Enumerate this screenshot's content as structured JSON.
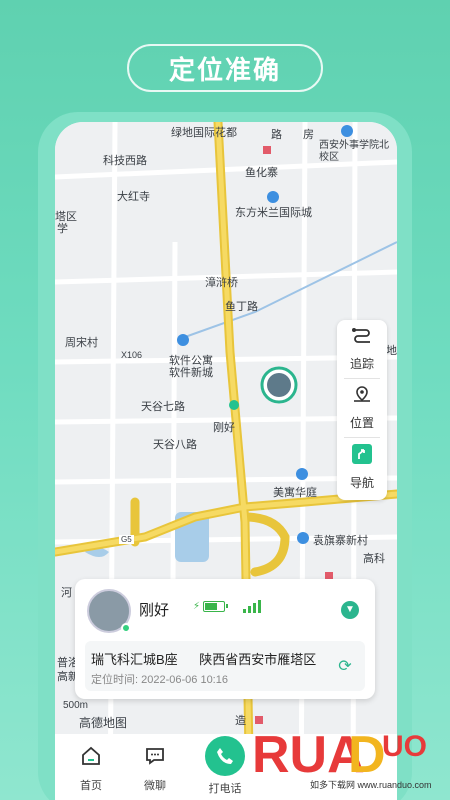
{
  "banner": {
    "title": "定位准确"
  },
  "map": {
    "labels": [
      "绿地国际花都",
      "科技西路",
      "鱼化寨",
      "西安外事学院北校区",
      "大红寺",
      "东方米兰国际城",
      "漳浒桥",
      "鱼丁路",
      "周宋村",
      "软件公寓",
      "软件新城",
      "X106",
      "天谷七路",
      "刚好",
      "天谷八路",
      "美寓华庭",
      "袁旗寨新村",
      "高科",
      "G5",
      "河",
      "普洛",
      "高新",
      "500m",
      "高德地图",
      "塔区",
      "学",
      "房",
      "路",
      "基地",
      "造"
    ],
    "logo": "高德地图"
  },
  "side_panel": {
    "items": [
      {
        "label": "追踪",
        "icon": "route-icon"
      },
      {
        "label": "位置",
        "icon": "map-pin-icon"
      },
      {
        "label": "导航",
        "icon": "navigation-icon"
      }
    ]
  },
  "device": {
    "name": "刚好",
    "battery_level": 0.6,
    "signal_bars": 4,
    "address_parts": [
      "瑞飞科汇城B座",
      "陕西省西安市雁塔区"
    ],
    "time_label": "定位时间:",
    "time_value": "2022-06-06 10:16"
  },
  "nav": {
    "items": [
      {
        "label": "首页",
        "icon": "home-icon"
      },
      {
        "label": "微聊",
        "icon": "chat-icon"
      },
      {
        "label": "打电话",
        "icon": "phone-icon"
      }
    ]
  },
  "watermark": {
    "text": "RUANDUO",
    "subtext": "如多下载网 www.ruanduo.com"
  },
  "colors": {
    "accent": "#23c28f",
    "road_major": "#f4cf3a",
    "map_bg": "#eef0f2"
  }
}
